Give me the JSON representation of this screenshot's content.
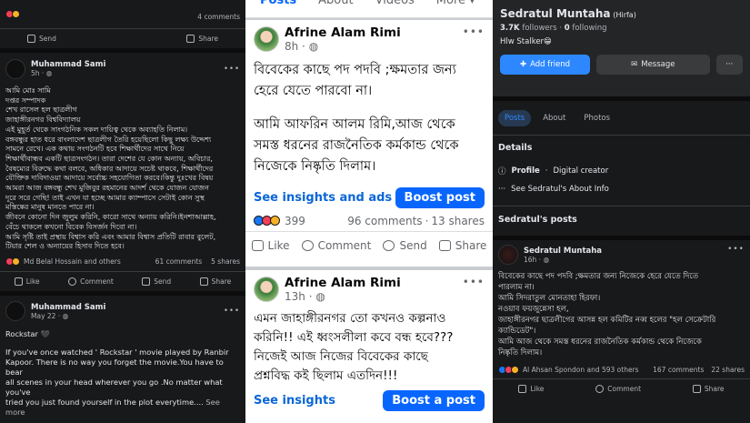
{
  "left_feed": {
    "top_post": {
      "comments": "4 comments",
      "send_label": "Send",
      "share_label": "Share"
    },
    "post1": {
      "author": "Muhammad Sami",
      "time": "5h · ",
      "lines": [
        "আমি মোঃ সামি",
        "দপ্তর সম্পাদক",
        "শেখ রাসেল হল ছাত্রলীগ",
        "জাহাঙ্গীরনগর বিশ্ববিদ্যালয়",
        "এই মুহূর্ত থেকে সাংগঠনিক সকল দায়িত্ব থেকে অব্যাহতি নিলাম।",
        "বঙ্গবন্ধুর হাত ধরে বাংলাদেশ ছাত্রলীগ তৈরি হয়েছিলো কিছু লক্ষ্য উদ্দেশ্য",
        "সামনে রেখে। এক কথায় সংগঠনটি হবে শিক্ষার্থীদের সাথে নিয়ে",
        "শিক্ষার্থীবান্ধব একটি ছাত্রসংগঠন। তারা দেশের যে কোন অন্যায়, অবিচার,",
        "বৈষম্যের বিরুদ্ধে কথা বলবে, অধিকার আদায়ে সচেষ্ট থাকবে, শিক্ষার্থীদের",
        "যৌক্তিক দাবিদাওয়া আদায়ে সর্বোচ্চ সহযোগিতা করবে।কিন্তু দুঃখের বিষয়",
        "আমরা আজ বঙ্গবন্ধু শেখ মুজিবুর রহমানের আদর্শ থেকে যোজন যোজন",
        "দূরে সরে গেছি! তাই এখন যা হচ্ছে আমার ক্যাম্পাসে সেটাই কোন সুস্থ",
        "মস্তিষ্কের মানুষ মানতে পারে না।",
        "জীবনে কোনো দিন জুলুম করিনি, কারো সাথে অন্যায় করিনি।ইনশাআল্লাহ,",
        "বেঁচে থাকলে কখনো বিবেক বিসর্জন দিবো না।",
        "আমি সৃষ্টি তাই প্রস্থায় বিশ্বাস করি এবং আমার বিশ্বাস প্রতিটি রাবার বুলেট,",
        "টিয়ার শেল ও অন্যায়ের হিসাব দিতে হবে।"
      ],
      "reactors": "Md Belal Hossain and others",
      "comments": "61 comments",
      "shares": "5 shares",
      "like_label": "Like",
      "comment_label": "Comment",
      "send_label": "Send",
      "share_label": "Share"
    },
    "post2": {
      "author": "Muhammad Sami",
      "time": "May 22 · ",
      "first_line": "Rockstar 🖤",
      "lines": [
        "If you've once watched ' Rockstar ' movie played by Ranbir",
        "Kapoor. There is no way you forget the movie.You have to bear",
        "all scenes in your head wherever you go .No matter what you've",
        "tried you just found yourself in the plot everytime...."
      ],
      "see_more": "See more"
    }
  },
  "middle_feed": {
    "top_tabs": [
      "Posts",
      "About",
      "Videos",
      "More ▾"
    ],
    "post1": {
      "author": "Afrine Alam Rimi",
      "time": "8h · ",
      "lines": [
        "বিবেকের কাছে পদ পদবি ;ক্ষমতার জন্য",
        "হেরে যেতে পারবো না।",
        "",
        "আমি আফরিন আলম রিমি,আজ থেকে",
        "সমস্ত ধরনের রাজনৈতিক কর্মকান্ড থেকে",
        "নিজেকে নিষ্কৃতি দিলাম।"
      ],
      "insights": "See insights and ads",
      "boost": "Boost post",
      "reaction_count": "399",
      "comments": "96 comments",
      "shares": "13 shares",
      "like_label": "Like",
      "comment_label": "Comment",
      "send_label": "Send",
      "share_label": "Share"
    },
    "post2": {
      "author": "Afrine Alam Rimi",
      "time": "13h · ",
      "lines": [
        "এমন জাহাঙ্গীরনগর তো কখনও কল্পনাও",
        "করিনি!! এই ধ্বংসলীলা কবে বন্ধ হবে???",
        "নিজেই আজ নিজের বিবেকের কাছে",
        "প্রশ্নবিদ্ধ  কই ছিলাম এতদিন!!!"
      ],
      "insights": "See insights",
      "boost": "Boost a post"
    }
  },
  "right_profile": {
    "name": "Sedratul Muntaha",
    "alt_name": "(Hirfa)",
    "followers": "3.7K",
    "followers_label": "followers",
    "following": "0",
    "following_label": "following",
    "bio": "Hlw Stalker😁",
    "add_friend": "Add friend",
    "message": "Message",
    "tabs": [
      "Posts",
      "About",
      "Photos"
    ],
    "details_title": "Details",
    "profile_label": "Profile",
    "profile_value": "Digital creator",
    "about_link": "See Sedratul's About Info",
    "posts_title": "Sedratul's posts",
    "post": {
      "author": "Sedratul Muntaha",
      "time": "16h · ",
      "lines": [
        "বিবেকের কাছে পদ পদবি ;ক্ষমতার জন্য নিজেকে হেরে যেতে দিতে",
        "পারলাম না।",
        "আমি সিদরাতুল মোনতাহা হিরফা।",
        " নওয়াব ফয়জুন্নেসা হল,",
        "জাহাঙ্গীরনগর ছাত্রলীগের আসন্ন হল কমিটির নব্ব হলের \"হল সেক্রেটারি",
        "ক্যান্ডিডেট\"।",
        "আমি আজ থেকে সমস্ত ধরনের রাজনৈতিক কর্মকান্ড থেকে নিজেকে",
        "নিষ্কৃতি দিলাম।"
      ],
      "reactors": "Al Ahsan Spondon and 593 others",
      "comments": "167 comments",
      "shares": "22 shares",
      "like_label": "Like",
      "comment_label": "Comment",
      "share_label": "Share"
    }
  },
  "colors": {
    "fb_blue": "#0866ff",
    "dark_bg": "#18191a",
    "like_blue": "#1877f2",
    "love_red": "#f33e58",
    "haha_yellow": "#f7b125"
  }
}
